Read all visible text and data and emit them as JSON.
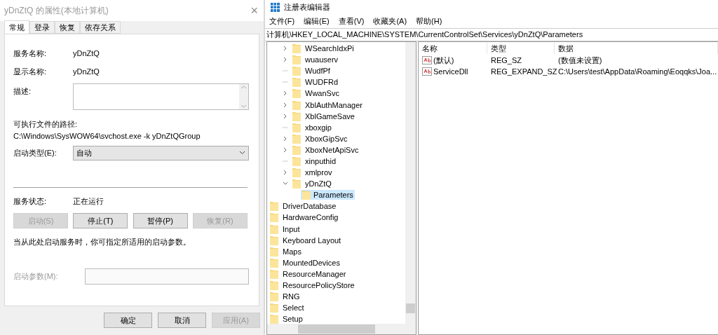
{
  "dialog": {
    "title": "yDnZtQ 的属性(本地计算机)",
    "close": "×",
    "tabs": [
      {
        "label": "常规",
        "selected": true
      },
      {
        "label": "登录",
        "selected": false
      },
      {
        "label": "恢复",
        "selected": false
      },
      {
        "label": "依存关系",
        "selected": false
      }
    ],
    "service_name": {
      "label": "服务名称:",
      "value": "yDnZtQ"
    },
    "display_name": {
      "label": "显示名称:",
      "value": "yDnZtQ"
    },
    "description": {
      "label": "描述:"
    },
    "path": {
      "label": "可执行文件的路径:",
      "value": "C:\\Windows\\SysWOW64\\svchost.exe -k yDnZtQGroup"
    },
    "startup_type": {
      "label": "启动类型(E):",
      "value": "自动"
    },
    "status": {
      "label": "服务状态:",
      "value": "正在运行"
    },
    "service_buttons": [
      {
        "label": "启动(S)",
        "disabled": true
      },
      {
        "label": "停止(T)",
        "disabled": false
      },
      {
        "label": "暂停(P)",
        "disabled": false
      },
      {
        "label": "恢复(R)",
        "disabled": true
      }
    ],
    "hint": "当从此处启动服务时，你可指定所适用的启动参数。",
    "start_params": {
      "label": "启动参数(M):",
      "disabled": true
    },
    "footer_buttons": [
      {
        "label": "确定",
        "disabled": false
      },
      {
        "label": "取消",
        "disabled": false
      },
      {
        "label": "应用(A)",
        "disabled": true
      }
    ]
  },
  "regedit": {
    "title": "注册表编辑器",
    "menu": [
      "文件(F)",
      "编辑(E)",
      "查看(V)",
      "收藏夹(A)",
      "帮助(H)"
    ],
    "address": "计算机\\HKEY_LOCAL_MACHINE\\SYSTEM\\CurrentControlSet\\Services\\yDnZtQ\\Parameters",
    "services_keys": [
      {
        "name": "WSearchIdxPi",
        "has_children": true,
        "expanded": false,
        "selected": false
      },
      {
        "name": "wuauserv",
        "has_children": true,
        "expanded": false,
        "selected": false
      },
      {
        "name": "WudfPf",
        "has_children": false,
        "selected": false
      },
      {
        "name": "WUDFRd",
        "has_children": false,
        "selected": false
      },
      {
        "name": "WwanSvc",
        "has_children": true,
        "expanded": false,
        "selected": false
      },
      {
        "name": "XblAuthManager",
        "has_children": true,
        "expanded": false,
        "selected": false
      },
      {
        "name": "XblGameSave",
        "has_children": true,
        "expanded": false,
        "selected": false
      },
      {
        "name": "xboxgip",
        "has_children": false,
        "selected": false
      },
      {
        "name": "XboxGipSvc",
        "has_children": true,
        "expanded": false,
        "selected": false
      },
      {
        "name": "XboxNetApiSvc",
        "has_children": true,
        "expanded": false,
        "selected": false
      },
      {
        "name": "xinputhid",
        "has_children": false,
        "selected": false
      },
      {
        "name": "xmlprov",
        "has_children": true,
        "expanded": false,
        "selected": false
      },
      {
        "name": "yDnZtQ",
        "has_children": true,
        "expanded": true,
        "selected": false,
        "children": [
          {
            "name": "Parameters",
            "selected": true
          }
        ]
      }
    ],
    "system_keys": [
      "DriverDatabase",
      "HardwareConfig",
      "Input",
      "Keyboard Layout",
      "Maps",
      "MountedDevices",
      "ResourceManager",
      "ResourcePolicyStore",
      "RNG",
      "Select",
      "Setup"
    ],
    "columns": [
      "名称",
      "类型",
      "数据"
    ],
    "values": [
      {
        "name": "(默认)",
        "type": "REG_SZ",
        "data": "(数值未设置)"
      },
      {
        "name": "ServiceDll",
        "type": "REG_EXPAND_SZ",
        "data": "C:\\Users\\test\\AppData\\Roaming\\Eoqqks\\Joa..."
      }
    ]
  }
}
